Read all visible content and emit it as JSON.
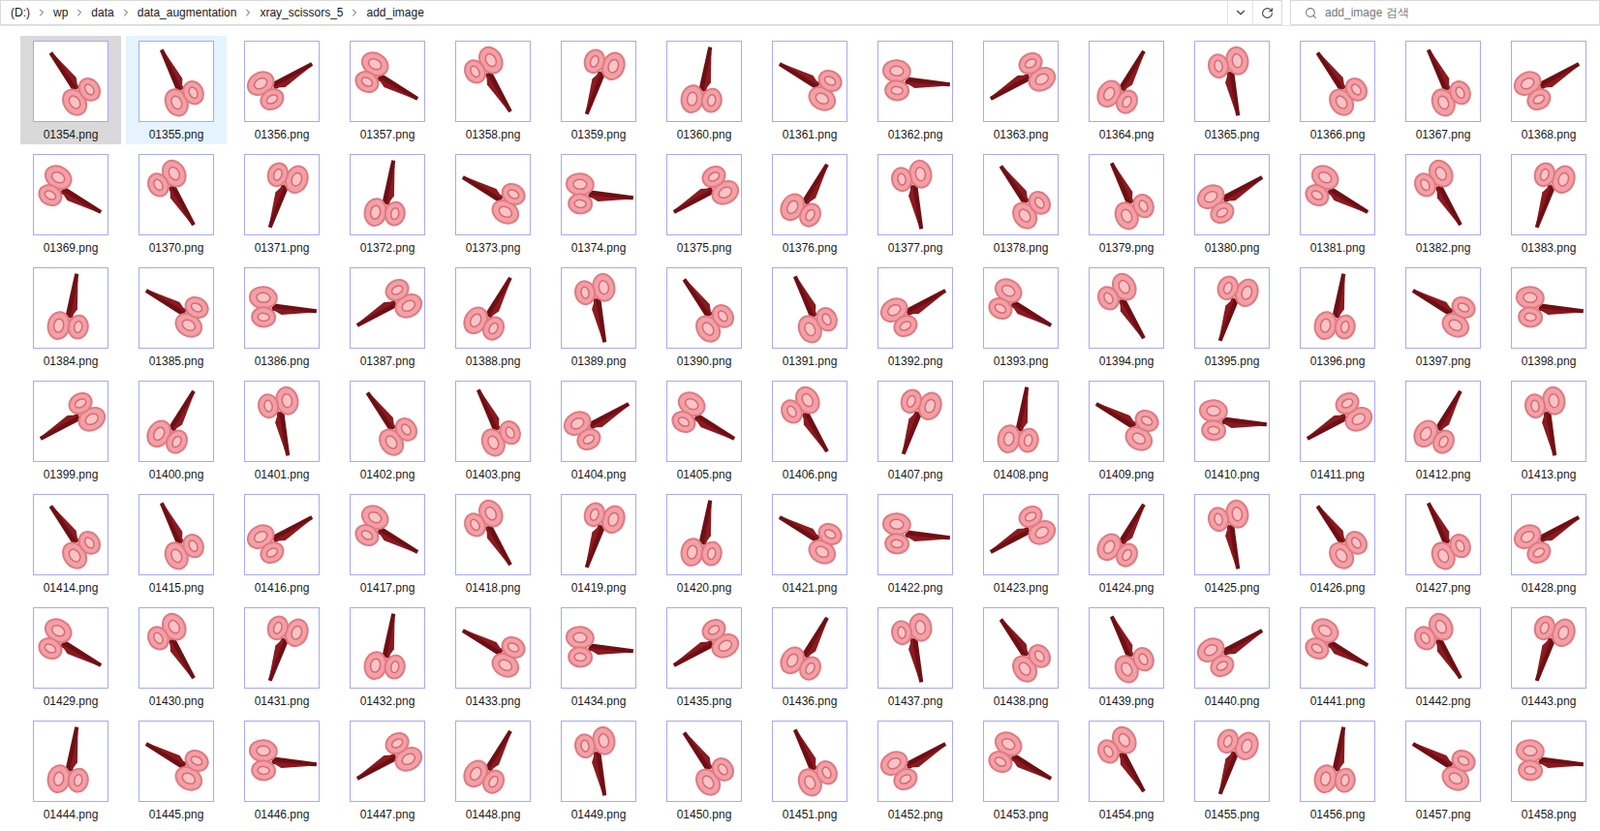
{
  "address_bar": {
    "path": [
      "(D:)",
      "wp",
      "data",
      "data_augmentation",
      "xray_scissors_5",
      "add_image"
    ]
  },
  "search": {
    "placeholder": "add_image 검색"
  },
  "files": [
    {
      "name": "01354.png",
      "selected": true,
      "hovered": false
    },
    {
      "name": "01355.png",
      "selected": false,
      "hovered": true
    },
    {
      "name": "01356.png",
      "selected": false,
      "hovered": false
    },
    {
      "name": "01357.png",
      "selected": false,
      "hovered": false
    },
    {
      "name": "01358.png",
      "selected": false,
      "hovered": false
    },
    {
      "name": "01359.png",
      "selected": false,
      "hovered": false
    },
    {
      "name": "01360.png",
      "selected": false,
      "hovered": false
    },
    {
      "name": "01361.png",
      "selected": false,
      "hovered": false
    },
    {
      "name": "01362.png",
      "selected": false,
      "hovered": false
    },
    {
      "name": "01363.png",
      "selected": false,
      "hovered": false
    },
    {
      "name": "01364.png",
      "selected": false,
      "hovered": false
    },
    {
      "name": "01365.png",
      "selected": false,
      "hovered": false
    },
    {
      "name": "01366.png",
      "selected": false,
      "hovered": false
    },
    {
      "name": "01367.png",
      "selected": false,
      "hovered": false
    },
    {
      "name": "01368.png",
      "selected": false,
      "hovered": false
    },
    {
      "name": "01369.png",
      "selected": false,
      "hovered": false
    },
    {
      "name": "01370.png",
      "selected": false,
      "hovered": false
    },
    {
      "name": "01371.png",
      "selected": false,
      "hovered": false
    },
    {
      "name": "01372.png",
      "selected": false,
      "hovered": false
    },
    {
      "name": "01373.png",
      "selected": false,
      "hovered": false
    },
    {
      "name": "01374.png",
      "selected": false,
      "hovered": false
    },
    {
      "name": "01375.png",
      "selected": false,
      "hovered": false
    },
    {
      "name": "01376.png",
      "selected": false,
      "hovered": false
    },
    {
      "name": "01377.png",
      "selected": false,
      "hovered": false
    },
    {
      "name": "01378.png",
      "selected": false,
      "hovered": false
    },
    {
      "name": "01379.png",
      "selected": false,
      "hovered": false
    },
    {
      "name": "01380.png",
      "selected": false,
      "hovered": false
    },
    {
      "name": "01381.png",
      "selected": false,
      "hovered": false
    },
    {
      "name": "01382.png",
      "selected": false,
      "hovered": false
    },
    {
      "name": "01383.png",
      "selected": false,
      "hovered": false
    },
    {
      "name": "01384.png",
      "selected": false,
      "hovered": false
    },
    {
      "name": "01385.png",
      "selected": false,
      "hovered": false
    },
    {
      "name": "01386.png",
      "selected": false,
      "hovered": false
    },
    {
      "name": "01387.png",
      "selected": false,
      "hovered": false
    },
    {
      "name": "01388.png",
      "selected": false,
      "hovered": false
    },
    {
      "name": "01389.png",
      "selected": false,
      "hovered": false
    },
    {
      "name": "01390.png",
      "selected": false,
      "hovered": false
    },
    {
      "name": "01391.png",
      "selected": false,
      "hovered": false
    },
    {
      "name": "01392.png",
      "selected": false,
      "hovered": false
    },
    {
      "name": "01393.png",
      "selected": false,
      "hovered": false
    },
    {
      "name": "01394.png",
      "selected": false,
      "hovered": false
    },
    {
      "name": "01395.png",
      "selected": false,
      "hovered": false
    },
    {
      "name": "01396.png",
      "selected": false,
      "hovered": false
    },
    {
      "name": "01397.png",
      "selected": false,
      "hovered": false
    },
    {
      "name": "01398.png",
      "selected": false,
      "hovered": false
    },
    {
      "name": "01399.png",
      "selected": false,
      "hovered": false
    },
    {
      "name": "01400.png",
      "selected": false,
      "hovered": false
    },
    {
      "name": "01401.png",
      "selected": false,
      "hovered": false
    },
    {
      "name": "01402.png",
      "selected": false,
      "hovered": false
    },
    {
      "name": "01403.png",
      "selected": false,
      "hovered": false
    },
    {
      "name": "01404.png",
      "selected": false,
      "hovered": false
    },
    {
      "name": "01405.png",
      "selected": false,
      "hovered": false
    },
    {
      "name": "01406.png",
      "selected": false,
      "hovered": false
    },
    {
      "name": "01407.png",
      "selected": false,
      "hovered": false
    },
    {
      "name": "01408.png",
      "selected": false,
      "hovered": false
    },
    {
      "name": "01409.png",
      "selected": false,
      "hovered": false
    },
    {
      "name": "01410.png",
      "selected": false,
      "hovered": false
    },
    {
      "name": "01411.png",
      "selected": false,
      "hovered": false
    },
    {
      "name": "01412.png",
      "selected": false,
      "hovered": false
    },
    {
      "name": "01413.png",
      "selected": false,
      "hovered": false
    },
    {
      "name": "01414.png",
      "selected": false,
      "hovered": false
    },
    {
      "name": "01415.png",
      "selected": false,
      "hovered": false
    },
    {
      "name": "01416.png",
      "selected": false,
      "hovered": false
    },
    {
      "name": "01417.png",
      "selected": false,
      "hovered": false
    },
    {
      "name": "01418.png",
      "selected": false,
      "hovered": false
    },
    {
      "name": "01419.png",
      "selected": false,
      "hovered": false
    },
    {
      "name": "01420.png",
      "selected": false,
      "hovered": false
    },
    {
      "name": "01421.png",
      "selected": false,
      "hovered": false
    },
    {
      "name": "01422.png",
      "selected": false,
      "hovered": false
    },
    {
      "name": "01423.png",
      "selected": false,
      "hovered": false
    },
    {
      "name": "01424.png",
      "selected": false,
      "hovered": false
    },
    {
      "name": "01425.png",
      "selected": false,
      "hovered": false
    },
    {
      "name": "01426.png",
      "selected": false,
      "hovered": false
    },
    {
      "name": "01427.png",
      "selected": false,
      "hovered": false
    },
    {
      "name": "01428.png",
      "selected": false,
      "hovered": false
    },
    {
      "name": "01429.png",
      "selected": false,
      "hovered": false
    },
    {
      "name": "01430.png",
      "selected": false,
      "hovered": false
    },
    {
      "name": "01431.png",
      "selected": false,
      "hovered": false
    },
    {
      "name": "01432.png",
      "selected": false,
      "hovered": false
    },
    {
      "name": "01433.png",
      "selected": false,
      "hovered": false
    },
    {
      "name": "01434.png",
      "selected": false,
      "hovered": false
    },
    {
      "name": "01435.png",
      "selected": false,
      "hovered": false
    },
    {
      "name": "01436.png",
      "selected": false,
      "hovered": false
    },
    {
      "name": "01437.png",
      "selected": false,
      "hovered": false
    },
    {
      "name": "01438.png",
      "selected": false,
      "hovered": false
    },
    {
      "name": "01439.png",
      "selected": false,
      "hovered": false
    },
    {
      "name": "01440.png",
      "selected": false,
      "hovered": false
    },
    {
      "name": "01441.png",
      "selected": false,
      "hovered": false
    },
    {
      "name": "01442.png",
      "selected": false,
      "hovered": false
    },
    {
      "name": "01443.png",
      "selected": false,
      "hovered": false
    },
    {
      "name": "01444.png",
      "selected": false,
      "hovered": false
    },
    {
      "name": "01445.png",
      "selected": false,
      "hovered": false
    },
    {
      "name": "01446.png",
      "selected": false,
      "hovered": false
    },
    {
      "name": "01447.png",
      "selected": false,
      "hovered": false
    },
    {
      "name": "01448.png",
      "selected": false,
      "hovered": false
    },
    {
      "name": "01449.png",
      "selected": false,
      "hovered": false
    },
    {
      "name": "01450.png",
      "selected": false,
      "hovered": false
    },
    {
      "name": "01451.png",
      "selected": false,
      "hovered": false
    },
    {
      "name": "01452.png",
      "selected": false,
      "hovered": false
    },
    {
      "name": "01453.png",
      "selected": false,
      "hovered": false
    },
    {
      "name": "01454.png",
      "selected": false,
      "hovered": false
    },
    {
      "name": "01455.png",
      "selected": false,
      "hovered": false
    },
    {
      "name": "01456.png",
      "selected": false,
      "hovered": false
    },
    {
      "name": "01457.png",
      "selected": false,
      "hovered": false
    },
    {
      "name": "01458.png",
      "selected": false,
      "hovered": false
    }
  ]
}
